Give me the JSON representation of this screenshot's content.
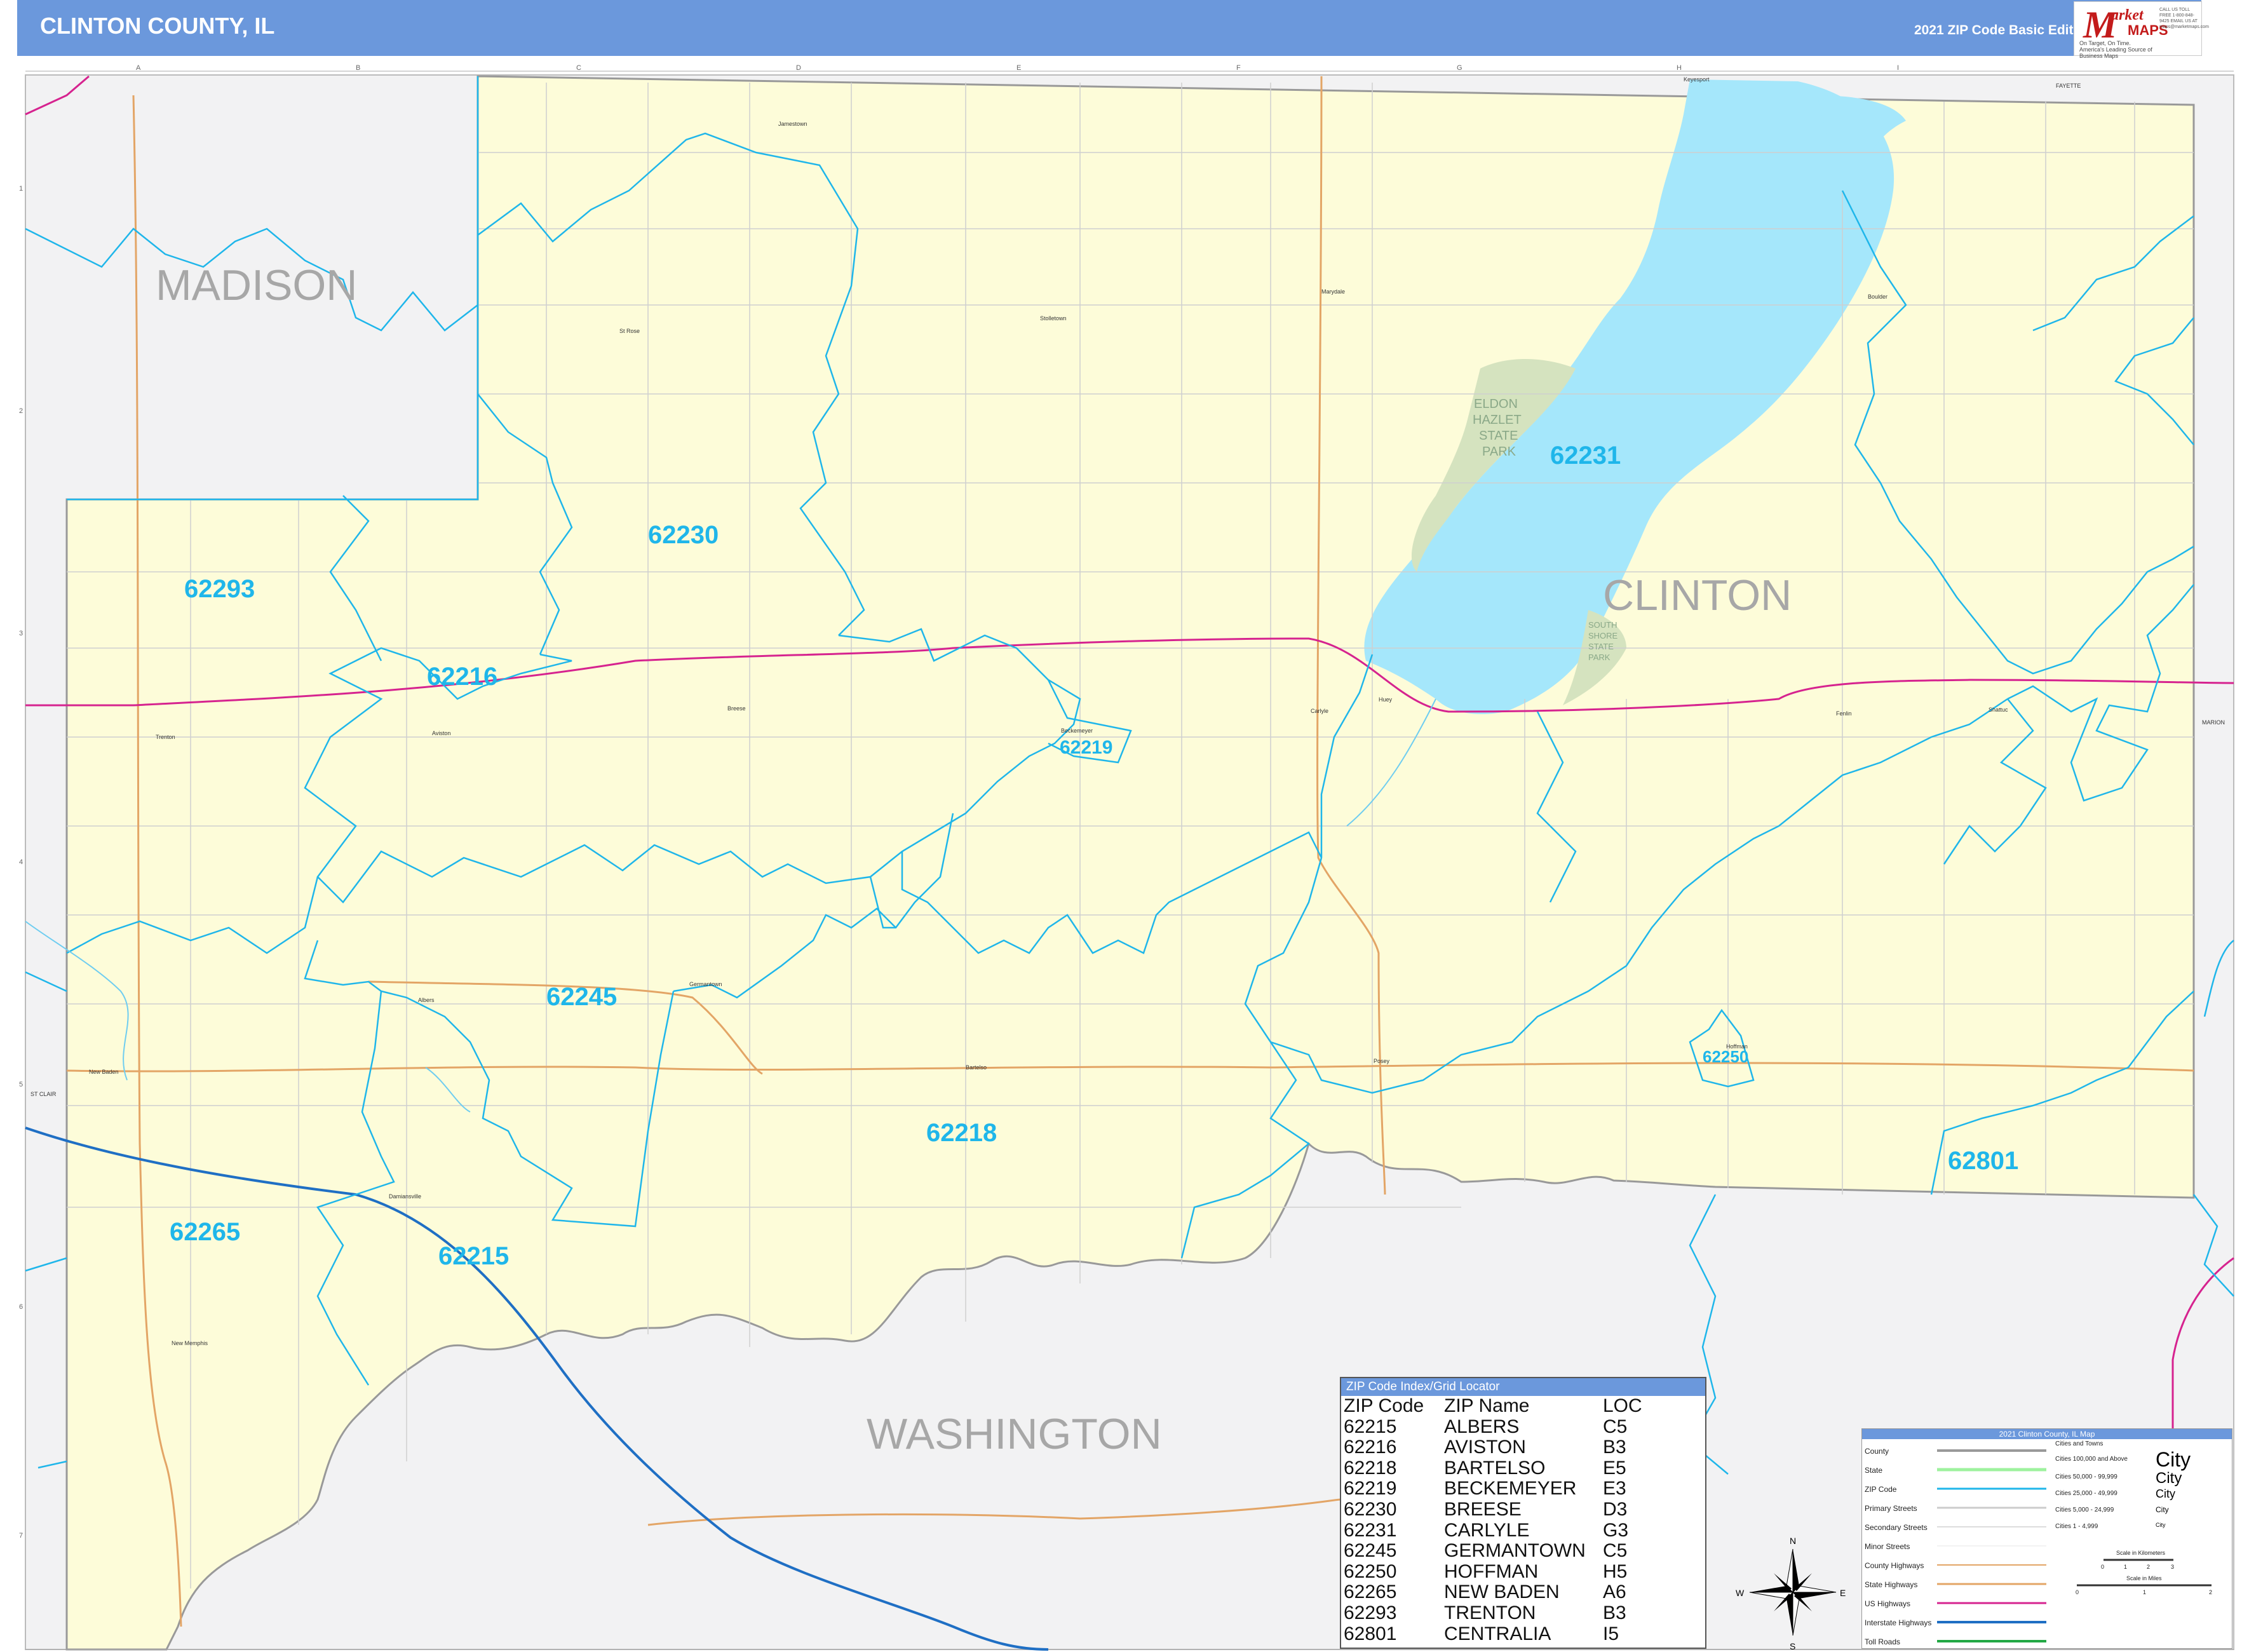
{
  "header": {
    "title": "CLINTON COUNTY, IL",
    "edition": "2021 ZIP Code Basic Edition"
  },
  "logo": {
    "letter": "M",
    "market": "arket",
    "maps": "MAPS",
    "tagline": "On Target, On Time. America's Leading Source of Business Maps",
    "contact": "CALL US TOLL FREE 1-800-848-9425 EMAIL US AT maps@marketmaps.com"
  },
  "colors": {
    "header": "#6b98dc",
    "county_fill": "#fdfcd9",
    "neighbor_fill": "#f2f2f3",
    "water": "#a5e7fb",
    "zip_boundary": "#1fb6ea",
    "us_highway": "#d6238f",
    "interstate": "#1f6fc4",
    "state_highway": "#e3a566",
    "park": "#d5e3bf"
  },
  "counties": {
    "madison": "MADISON",
    "clinton": "CLINTON",
    "washington": "WASHINGTON",
    "st_clair": "ST CLAIR",
    "fayette": "FAYETTE",
    "marion": "MARION"
  },
  "zips": [
    "62293",
    "62216",
    "62230",
    "62231",
    "62219",
    "62245",
    "62218",
    "62265",
    "62215",
    "62250",
    "62801"
  ],
  "towns": [
    "Keyesport",
    "Jamestown",
    "St Rose",
    "Stolletown",
    "Marydale",
    "Boulder",
    "Aviston",
    "Breese",
    "Beckemeyer",
    "Carlyle",
    "Huey",
    "Trenton",
    "Fenlin",
    "Shattuc",
    "Germantown",
    "Albers",
    "New Baden",
    "Bartelso",
    "Posey",
    "Hoffman",
    "Damiansville",
    "New Memphis"
  ],
  "park": {
    "eldon": [
      "ELDON",
      "HAZLET",
      "STATE",
      "PARK"
    ],
    "south_shore": [
      "SOUTH",
      "SHORE",
      "STATE",
      "PARK"
    ]
  },
  "grid": {
    "columns": [
      "A",
      "B",
      "C",
      "D",
      "E",
      "F",
      "G",
      "H",
      "I"
    ],
    "rows": [
      "1",
      "2",
      "3",
      "4",
      "5",
      "6",
      "7"
    ]
  },
  "index": {
    "title": "ZIP Code Index/Grid Locator",
    "headers": [
      "ZIP Code",
      "ZIP Name",
      "LOC"
    ],
    "rows": [
      [
        "62215",
        "ALBERS",
        "C5"
      ],
      [
        "62216",
        "AVISTON",
        "B3"
      ],
      [
        "62218",
        "BARTELSO",
        "E5"
      ],
      [
        "62219",
        "BECKEMEYER",
        "E3"
      ],
      [
        "62230",
        "BREESE",
        "D3"
      ],
      [
        "62231",
        "CARLYLE",
        "G3"
      ],
      [
        "62245",
        "GERMANTOWN",
        "C5"
      ],
      [
        "62250",
        "HOFFMAN",
        "H5"
      ],
      [
        "62265",
        "NEW BADEN",
        "A6"
      ],
      [
        "62293",
        "TRENTON",
        "B3"
      ],
      [
        "62801",
        "CENTRALIA",
        "I5"
      ]
    ]
  },
  "legend": {
    "title": "2021 Clinton County, IL Map",
    "items": [
      "County",
      "State",
      "ZIP Code",
      "Primary Streets",
      "Secondary Streets",
      "Minor Streets",
      "County Highways",
      "State Highways",
      "US Highways",
      "Interstate Highways",
      "Toll Roads"
    ],
    "cities_title": "Cities and Towns",
    "city_classes": [
      "Cities 100,000 and Above",
      "Cities 50,000 - 99,999",
      "Cities 25,000 - 49,999",
      "Cities 5,000 - 24,999",
      "Cities 1 - 4,999"
    ],
    "city_samples": [
      "City",
      "City",
      "City",
      "City",
      "City"
    ],
    "scale_km": "Scale in Kilometers",
    "scale_miles": "Scale in Miles",
    "km_ticks": [
      "0",
      "1",
      "2",
      "3"
    ],
    "mile_ticks": [
      "0",
      "1",
      "2"
    ]
  },
  "compass": {
    "n": "N",
    "s": "S",
    "e": "E",
    "w": "W"
  }
}
